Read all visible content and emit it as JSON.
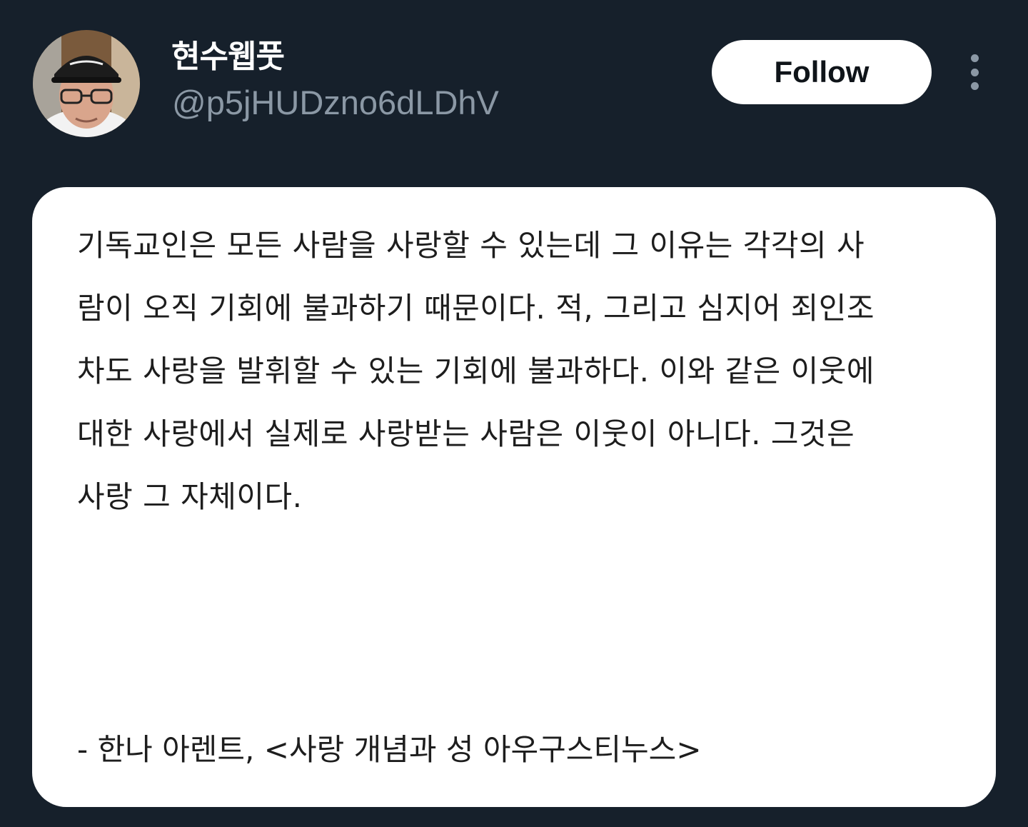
{
  "profile": {
    "display_name": "현수웹풋",
    "handle": "@p5jHUDzno6dLDhV",
    "avatar_icon": "profile-photo"
  },
  "header": {
    "follow_label": "Follow",
    "more_icon": "more-vertical-icon"
  },
  "post": {
    "quote_lines": [
      " 기독교인은 모든 사람을 사랑할 수 있는데 그 이유는 각각의 사",
      "람이 오직 기회에 불과하기 때문이다. 적, 그리고 심지어 죄인조",
      "차도 사랑을 발휘할 수 있는 기회에 불과하다. 이와 같은 이웃에",
      "대한 사랑에서 실제로 사랑받는 사람은 이웃이 아니다. 그것은",
      "사랑 그 자체이다."
    ],
    "attribution": "- 한나 아렌트, <사랑 개념과 성 아우구스티누스>"
  },
  "colors": {
    "background": "#16202b",
    "handle": "#8b98a5",
    "card": "#ffffff",
    "text": "#1d1d1d"
  }
}
